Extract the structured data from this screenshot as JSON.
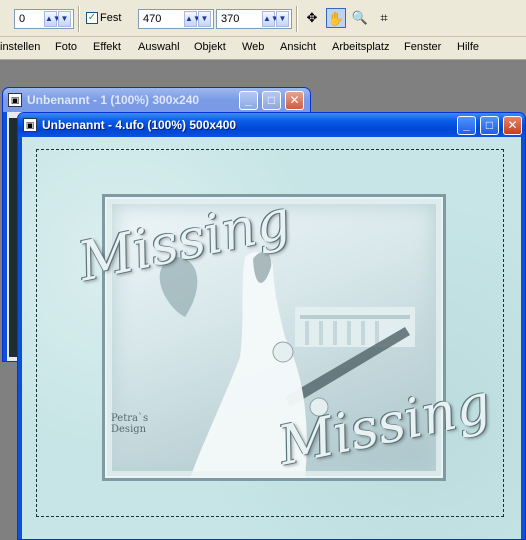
{
  "toolbar": {
    "field1_value": "0",
    "fixed_label": "Fest",
    "fixed_checked": true,
    "width_value": "470",
    "height_value": "370",
    "tools": [
      "move-tool-icon",
      "pan-tool-icon",
      "zoom-tool-icon",
      "crop-tool-icon"
    ]
  },
  "menu": {
    "items": [
      "instellen",
      "Foto",
      "Effekt",
      "Auswahl",
      "Objekt",
      "Web",
      "Ansicht",
      "Arbeitsplatz",
      "Fenster",
      "Hilfe"
    ]
  },
  "window_back": {
    "title": "Unbenannt - 1 (100%) 300x240"
  },
  "window_front": {
    "title": "Unbenannt - 4.ufo (100%) 500x400",
    "artwork": {
      "text_top": "Missing",
      "text_bottom": "Missing",
      "signature_line1": "Petra`s",
      "signature_line2": "Design"
    }
  },
  "colors": {
    "title_active": "#0a5fe9",
    "title_inactive": "#7a9be6",
    "canvas_bg": "#c7e5e6"
  }
}
